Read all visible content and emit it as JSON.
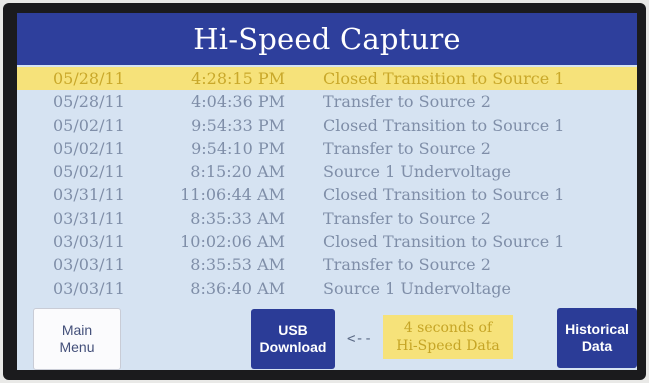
{
  "screen": {
    "title": "Hi-Speed Capture"
  },
  "records": [
    {
      "date": "05/28/11",
      "time": "4:28:15 PM",
      "event": "Closed Transition to Source 1",
      "selected": true
    },
    {
      "date": "05/28/11",
      "time": "4:04:36 PM",
      "event": "Transfer to Source 2",
      "selected": false
    },
    {
      "date": "05/02/11",
      "time": "9:54:33 PM",
      "event": "Closed Transition to Source 1",
      "selected": false
    },
    {
      "date": "05/02/11",
      "time": "9:54:10 PM",
      "event": "Transfer to Source 2",
      "selected": false
    },
    {
      "date": "05/02/11",
      "time": "8:15:20 AM",
      "event": "Source 1 Undervoltage",
      "selected": false
    },
    {
      "date": "03/31/11",
      "time": "11:06:44 AM",
      "event": "Closed Transition to Source 1",
      "selected": false
    },
    {
      "date": "03/31/11",
      "time": "8:35:33 AM",
      "event": "Transfer to Source 2",
      "selected": false
    },
    {
      "date": "03/03/11",
      "time": "10:02:06 AM",
      "event": "Closed Transition to Source 1",
      "selected": false
    },
    {
      "date": "03/03/11",
      "time": "8:35:53 AM",
      "event": "Transfer to Source 2",
      "selected": false
    },
    {
      "date": "03/03/11",
      "time": "8:36:40 AM",
      "event": "Source 1 Undervoltage",
      "selected": false
    }
  ],
  "footer": {
    "main_menu_line1": "Main",
    "main_menu_line2": "Menu",
    "usb_line1": "USB",
    "usb_line2": "Download",
    "arrow_text": "<--",
    "note_line1": "4 seconds of",
    "note_line2": "Hi-Speed Data",
    "historical_line1": "Historical",
    "historical_line2": "Data"
  },
  "colors": {
    "title_bar": "#2e3f9c",
    "screen_bg": "#d6e3f2",
    "highlight": "#f6e27a",
    "button_blue": "#2b3c97"
  }
}
